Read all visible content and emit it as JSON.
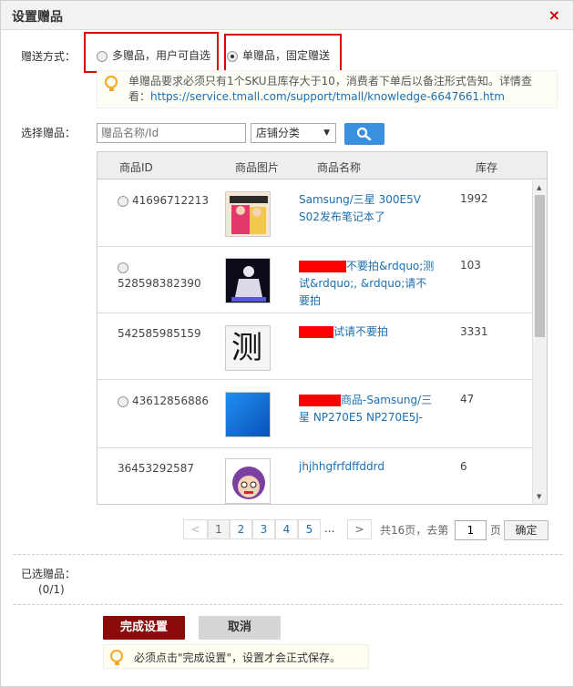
{
  "dialog": {
    "title": "设置赠品",
    "close_glyph": "×"
  },
  "gift_mode": {
    "label": "赠送方式：",
    "options": [
      {
        "label": "多赠品，用户可自选",
        "checked": false
      },
      {
        "label": "单赠品，固定赠送",
        "checked": true
      }
    ],
    "notice": "单赠品要求必须只有1个SKU且库存大于10，消费者下单后以备注形式告知。详情查看：",
    "notice_link": "https://service.tmall.com/support/tmall/knowledge-6647661.htm"
  },
  "select_gift": {
    "label": "选择赠品：",
    "search_placeholder": "赠品名称/Id",
    "category_selected": "店铺分类",
    "search_icon": "search-icon"
  },
  "table": {
    "columns": [
      "商品ID",
      "商品图片",
      "商品名称",
      "库存"
    ],
    "rows": [
      {
        "id": "41696712213",
        "name_before": "",
        "name_after": "Samsung/三星 300E5V S02发布笔记本了",
        "stock": "1992",
        "has_radio": true
      },
      {
        "id": "528598382390",
        "name_before": "",
        "name_after": "不要拍&rdquo;测试&rdquo;, &rdquo;请不要拍",
        "stock": "103",
        "has_radio": true
      },
      {
        "id": "542585985159",
        "name_before": "",
        "name_after": "试请不要拍",
        "stock": "3331",
        "has_radio": false,
        "thumb_text": "测"
      },
      {
        "id": "43612856886",
        "name_before": "",
        "name_after": "商品-Samsung/三星 NP270E5 NP270E5J-",
        "stock": "47",
        "has_radio": true
      },
      {
        "id": "36453292587",
        "name_before": "",
        "name_after": "jhjhhgfrfdffddrd",
        "stock": "6",
        "has_radio": false
      }
    ]
  },
  "pagination": {
    "prev": "<",
    "pages": [
      "1",
      "2",
      "3",
      "4",
      "5"
    ],
    "current": "1",
    "ellipsis": "...",
    "next": ">",
    "total_text": "共16页，去第",
    "goto_value": "1",
    "page_suffix": "页",
    "confirm": "确定"
  },
  "selected": {
    "label": "已选赠品：",
    "count": "(0/1)"
  },
  "actions": {
    "finish": "完成设置",
    "cancel": "取消",
    "tip": "必须点击\"完成设置\"，设置才会正式保存。"
  },
  "colors": {
    "accent": "#8b0a0a",
    "link": "#1a6fb3",
    "search_button": "#3b8fe0",
    "highlight_box": "#e00000"
  }
}
